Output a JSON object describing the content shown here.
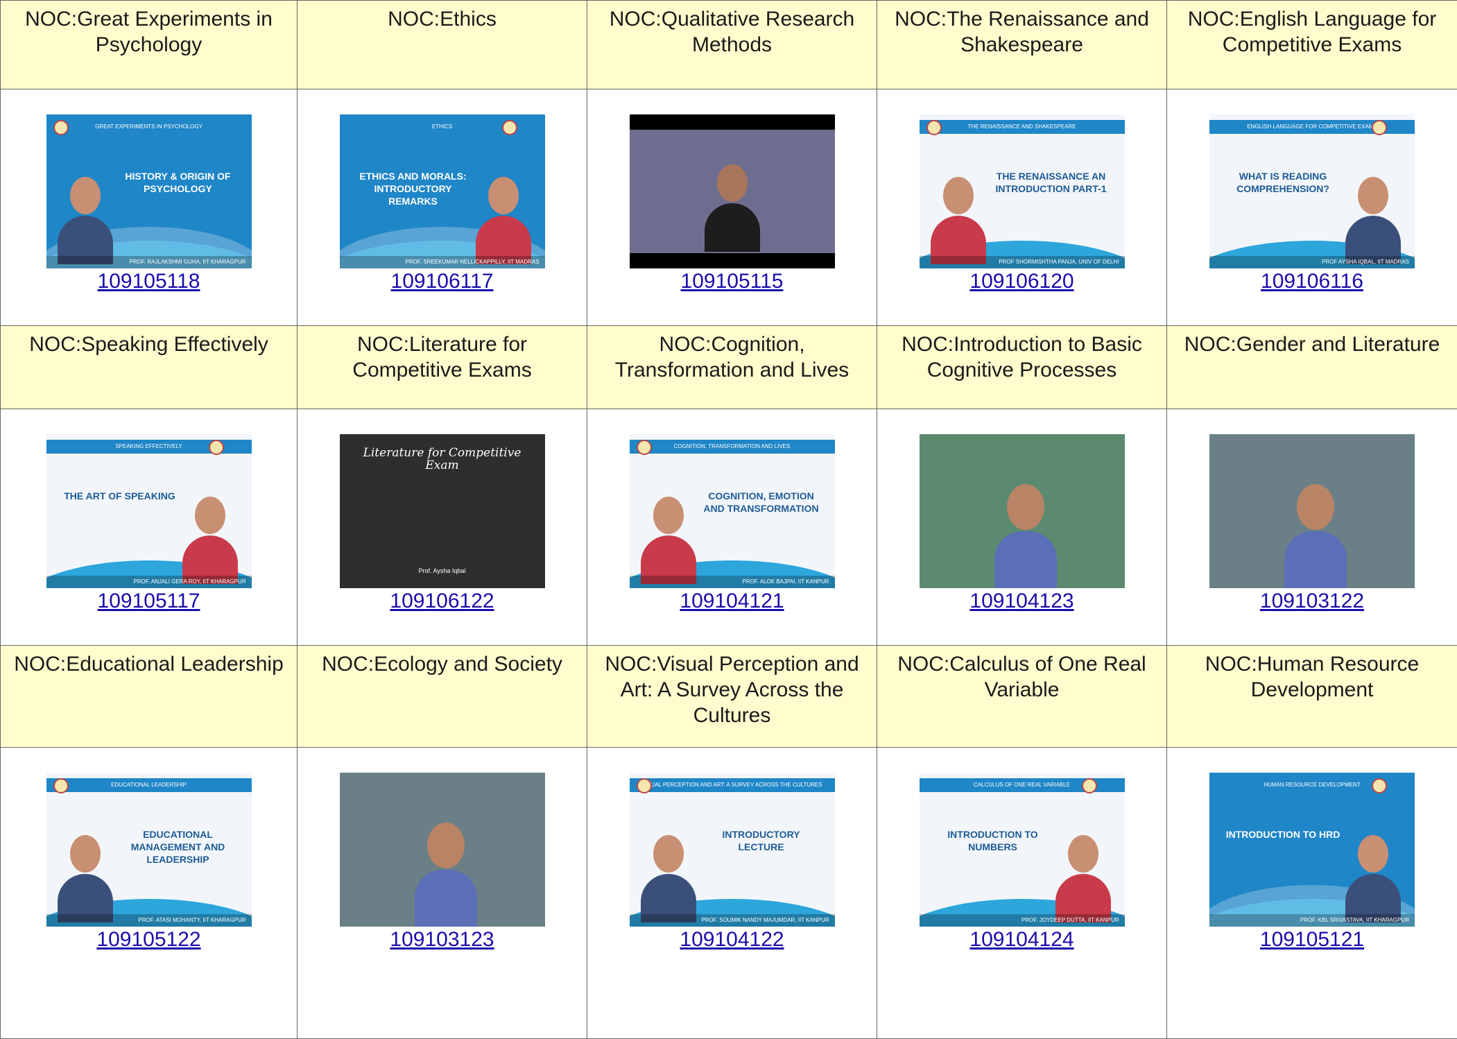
{
  "courses": [
    {
      "title": "NOC:Great Experiments in Psychology",
      "code": "109105118",
      "slide_title": "HISTORY & ORIGIN OF PSYCHOLOGY",
      "slide_header": "GREAT EXPERIMENTS IN PSYCHOLOGY",
      "slide_caption": "PROF. RAJLAKSHMI GUHA, IIT KHARAGPUR",
      "style": "blue-left-person"
    },
    {
      "title": "NOC:Ethics",
      "code": "109106117",
      "slide_title": "ETHICS AND MORALS: INTRODUCTORY REMARKS",
      "slide_header": "ETHICS",
      "slide_caption": "PROF. SREEKUMAR NELLICKAPPILLY, IIT MADRAS",
      "style": "blue-right-person"
    },
    {
      "title": "NOC:Qualitative Research Methods",
      "code": "109105115",
      "slide_title": "",
      "slide_header": "",
      "slide_caption": "",
      "style": "studio"
    },
    {
      "title": "NOC:The Renaissance and Shakespeare",
      "code": "109106120",
      "slide_title": "THE RENAISSANCE AN INTRODUCTION PART-1",
      "slide_header": "THE RENAISSANCE AND SHAKESPEARE",
      "slide_caption": "PROF SHORMISHTHA PANJA, UNIV OF DELHI",
      "style": "white-left-person"
    },
    {
      "title": "NOC:English Language for Competitive Exams",
      "code": "109106116",
      "slide_title": "WHAT IS READING COMPREHENSION?",
      "slide_header": "ENGLISH LANGUAGE FOR COMPETITIVE EXAMS",
      "slide_caption": "PROF AYSHA IQBAL, IIT MADRAS",
      "style": "white-right-person"
    },
    {
      "title": "NOC:Speaking Effectively",
      "code": "109105117",
      "slide_title": "THE ART OF SPEAKING",
      "slide_header": "SPEAKING EFFECTIVELY",
      "slide_caption": "PROF. ANJALI GERA ROY, IIT KHARAGPUR",
      "style": "light-right-person"
    },
    {
      "title": "NOC:Literature for Competitive Exams",
      "code": "109106122",
      "slide_title": "Literature for Competitive Exam",
      "slide_header": "",
      "slide_caption": "Prof. Aysha Iqbal",
      "style": "chalkboard"
    },
    {
      "title": "NOC:Cognition, Transformation and Lives",
      "code": "109104121",
      "slide_title": "COGNITION, EMOTION AND TRANSFORMATION",
      "slide_header": "COGNITION, TRANSFORMATION AND LIVES",
      "slide_caption": "PROF. ALOK BAJPAI, IIT KANPUR",
      "style": "white-left-person"
    },
    {
      "title": "NOC:Introduction to Basic Cognitive Processes",
      "code": "109104123",
      "slide_title": "",
      "slide_header": "",
      "slide_caption": "",
      "style": "classroom-green"
    },
    {
      "title": "NOC:Gender and Literature",
      "code": "109103122",
      "slide_title": "",
      "slide_header": "",
      "slide_caption": "",
      "style": "classroom"
    },
    {
      "title": "NOC:Educational Leadership",
      "code": "109105122",
      "slide_title": "EDUCATIONAL MANAGEMENT AND LEADERSHIP",
      "slide_header": "EDUCATIONAL LEADERSHIP",
      "slide_caption": "PROF. ATASI MOHANTY, IIT KHARAGPUR",
      "style": "white-left-person"
    },
    {
      "title": "NOC:Ecology and Society",
      "code": "109103123",
      "slide_title": "",
      "slide_header": "",
      "slide_caption": "",
      "style": "classroom"
    },
    {
      "title": "NOC:Visual Perception and Art: A Survey Across the Cultures",
      "code": "109104122",
      "slide_title": "INTRODUCTORY LECTURE",
      "slide_header": "VISUAL PERCEPTION AND ART: A SURVEY ACROSS THE CULTURES",
      "slide_caption": "PROF. SOUMIK NANDY MAJUMDAR, IIT KANPUR",
      "style": "white-left-person"
    },
    {
      "title": "NOC:Calculus of One Real Variable",
      "code": "109104124",
      "slide_title": "INTRODUCTION TO NUMBERS",
      "slide_header": "CALCULUS OF ONE REAL VARIABLE",
      "slide_caption": "PROF. JOYDEEP DUTTA, IIT KANPUR",
      "style": "white-right-person"
    },
    {
      "title": "NOC:Human Resource Development",
      "code": "109105121",
      "slide_title": "INTRODUCTION TO HRD",
      "slide_header": "HUMAN RESOURCE DEVELOPMENT",
      "slide_caption": "PROF. KBL SRIVASTAVA, IIT KHARAGPUR",
      "style": "blue-right-person"
    }
  ],
  "colors": {
    "title_bg": "#fffccd",
    "link": "#1a0dab",
    "slide_blue": "#1f86c7"
  }
}
